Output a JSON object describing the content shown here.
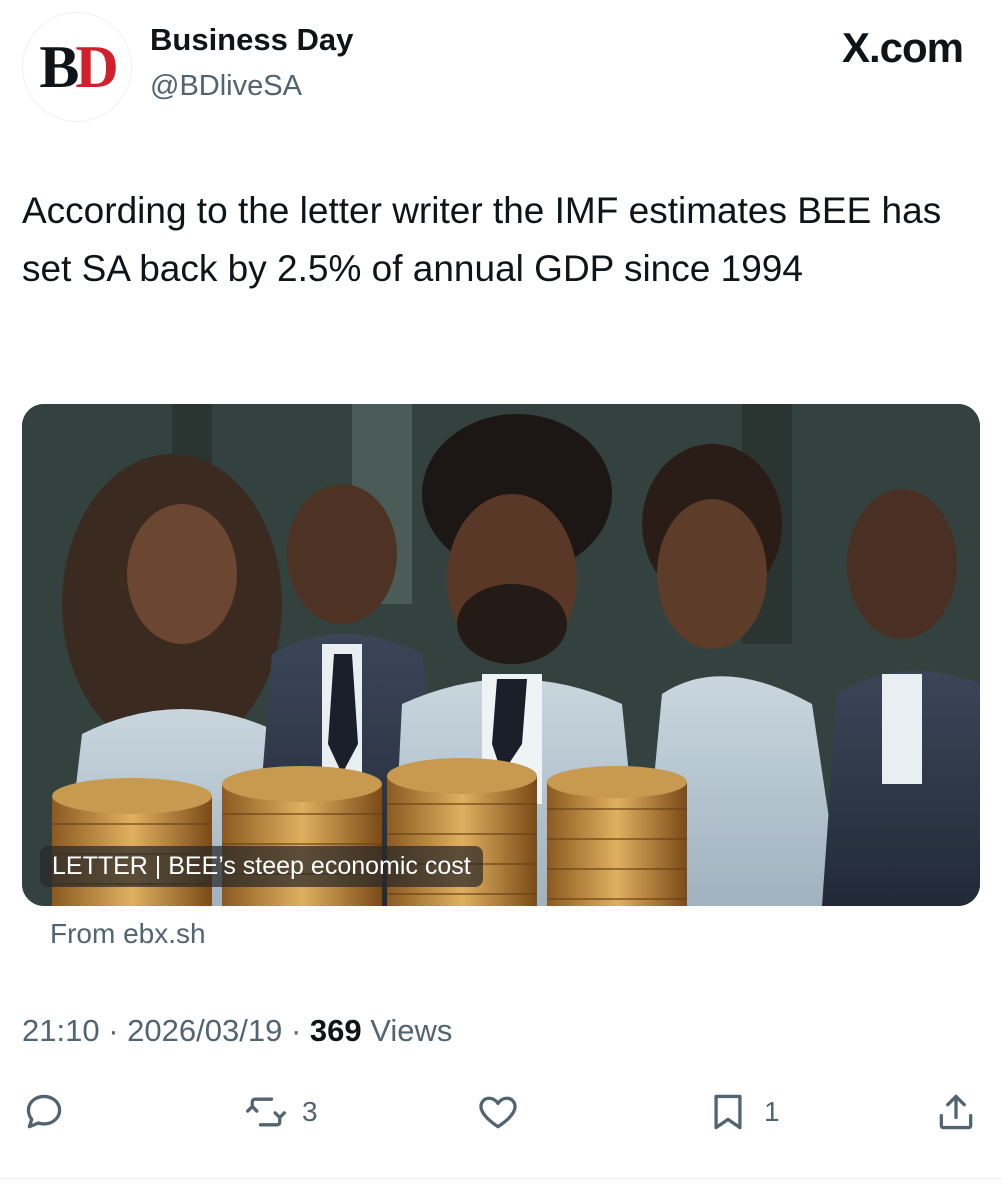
{
  "author": {
    "logo_letters": {
      "b": "B",
      "d": "D"
    },
    "name": "Business Day",
    "handle": "@BDliveSA"
  },
  "watermark": "X.com",
  "tweet": {
    "text": "According to the letter writer the IMF estimates BEE has set SA back by 2.5% of annual GDP since 1994"
  },
  "link_card": {
    "label": "LETTER | BEE’s steep economic cost",
    "source": "From ebx.sh"
  },
  "meta": {
    "time": "21:10",
    "separator": "·",
    "date": "2026/03/19",
    "views_count": "369",
    "views_label": "Views"
  },
  "actions": {
    "reply_icon": "reply-icon",
    "repost_icon": "repost-icon",
    "repost_count": "3",
    "like_icon": "heart-icon",
    "bookmark_icon": "bookmark-icon",
    "bookmark_count": "1",
    "share_icon": "share-icon"
  },
  "colors": {
    "text": "#0f1419",
    "secondary": "#536471",
    "brand_red": "#d1202b"
  }
}
